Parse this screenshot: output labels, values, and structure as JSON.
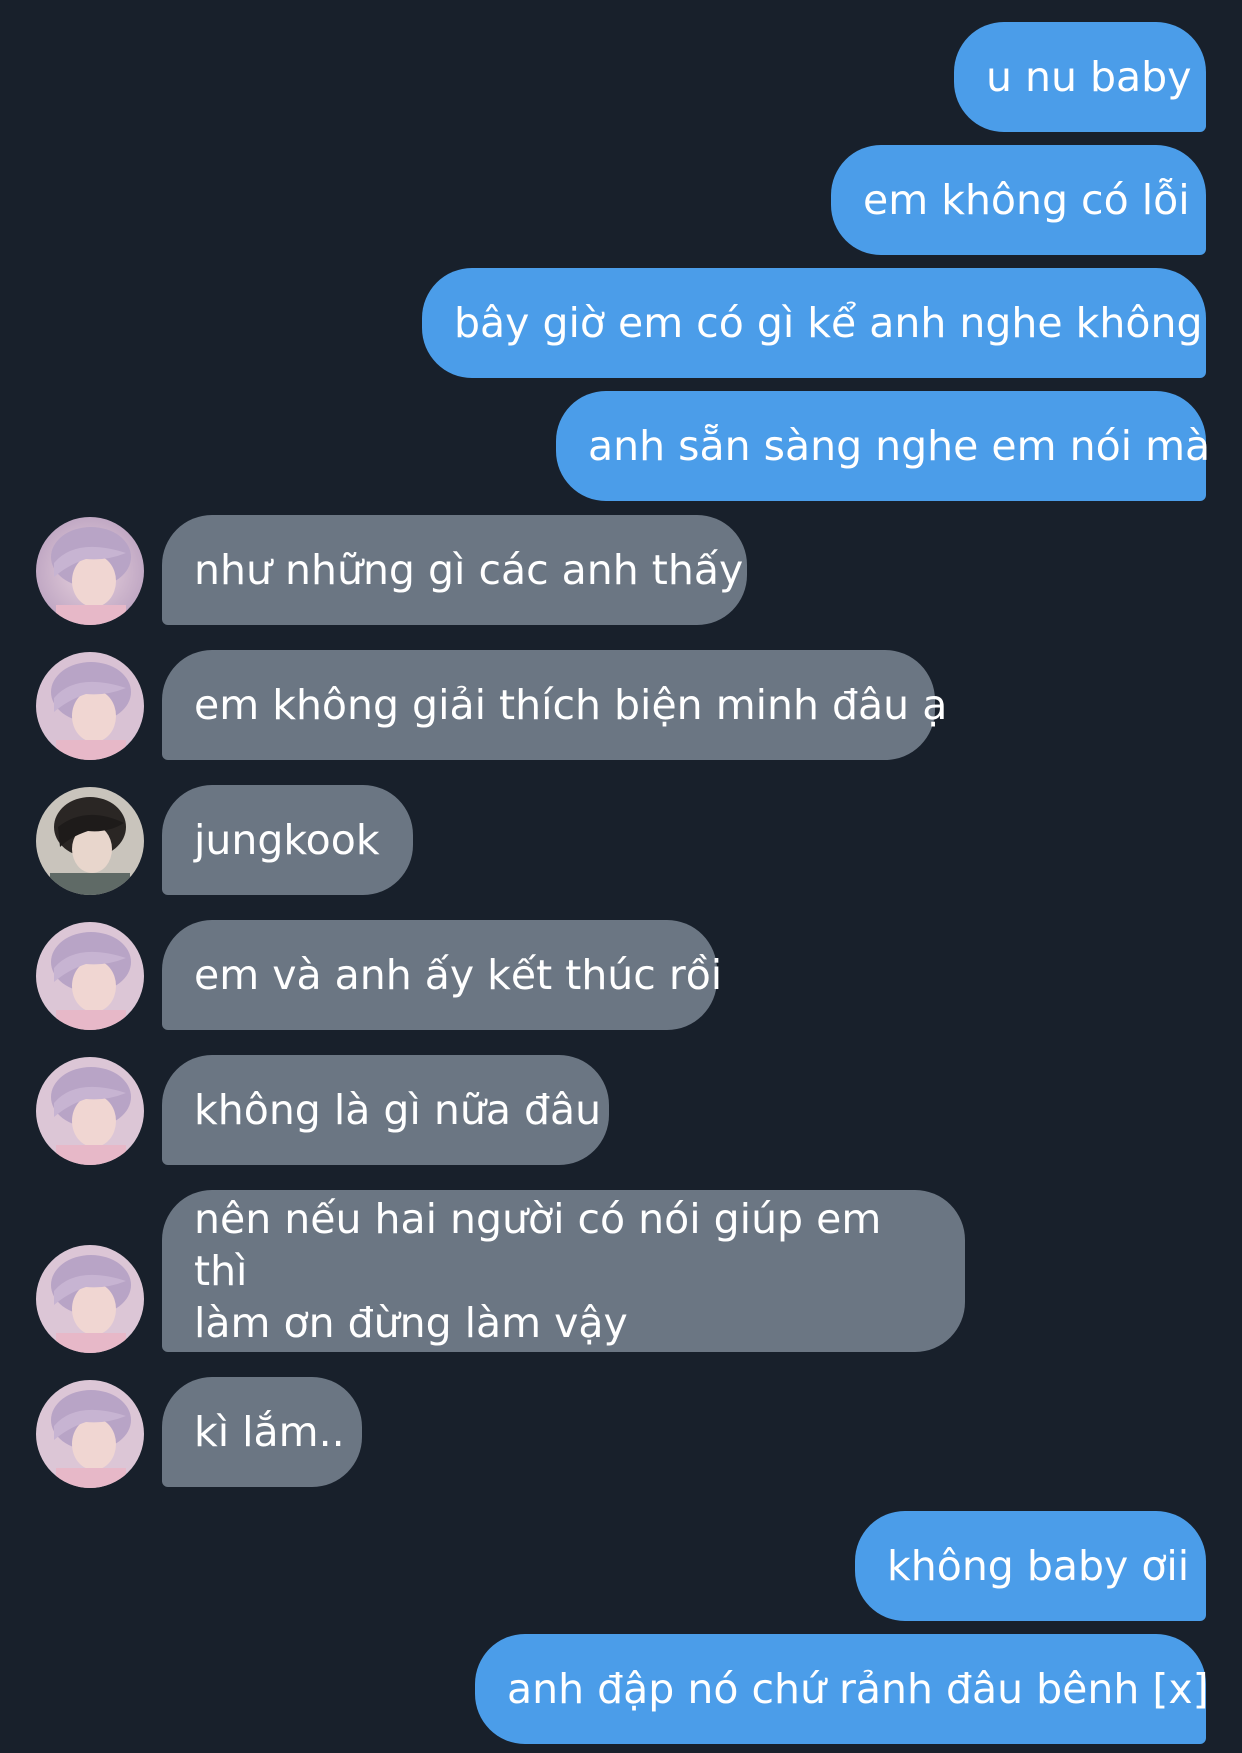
{
  "colors": {
    "background": "#18202b",
    "outgoing_bubble": "#4b9de9",
    "incoming_bubble": "#6b7683",
    "text": "#ffffff"
  },
  "messages": [
    {
      "direction": "outgoing",
      "text": "u nu baby"
    },
    {
      "direction": "outgoing",
      "text": "em không có lỗi"
    },
    {
      "direction": "outgoing",
      "text": "bây giờ em có gì kể anh nghe không"
    },
    {
      "direction": "outgoing",
      "text": "anh sẵn sàng nghe em nói mà"
    },
    {
      "direction": "incoming",
      "avatar": "pink-hair-avatar",
      "text": "như những gì các anh thấy"
    },
    {
      "direction": "incoming",
      "avatar": "pink-hair-avatar",
      "text": "em không giải thích biện minh đâu ạ"
    },
    {
      "direction": "incoming",
      "avatar": "dark-hair-avatar",
      "text": "jungkook"
    },
    {
      "direction": "incoming",
      "avatar": "pink-hair-avatar",
      "text": "em và anh ấy kết thúc rồi"
    },
    {
      "direction": "incoming",
      "avatar": "pink-hair-avatar",
      "text": "không là gì nữa đâu"
    },
    {
      "direction": "incoming",
      "avatar": "pink-hair-avatar",
      "text_line1": "nên nếu hai người có nói giúp em thì",
      "text_line2": "làm ơn đừng làm vậy"
    },
    {
      "direction": "incoming",
      "avatar": "pink-hair-avatar",
      "text": "kì lắm.."
    },
    {
      "direction": "outgoing",
      "text": "không baby ơii"
    },
    {
      "direction": "outgoing",
      "text": "anh đập nó chứ rảnh đâu bênh [x]"
    }
  ]
}
